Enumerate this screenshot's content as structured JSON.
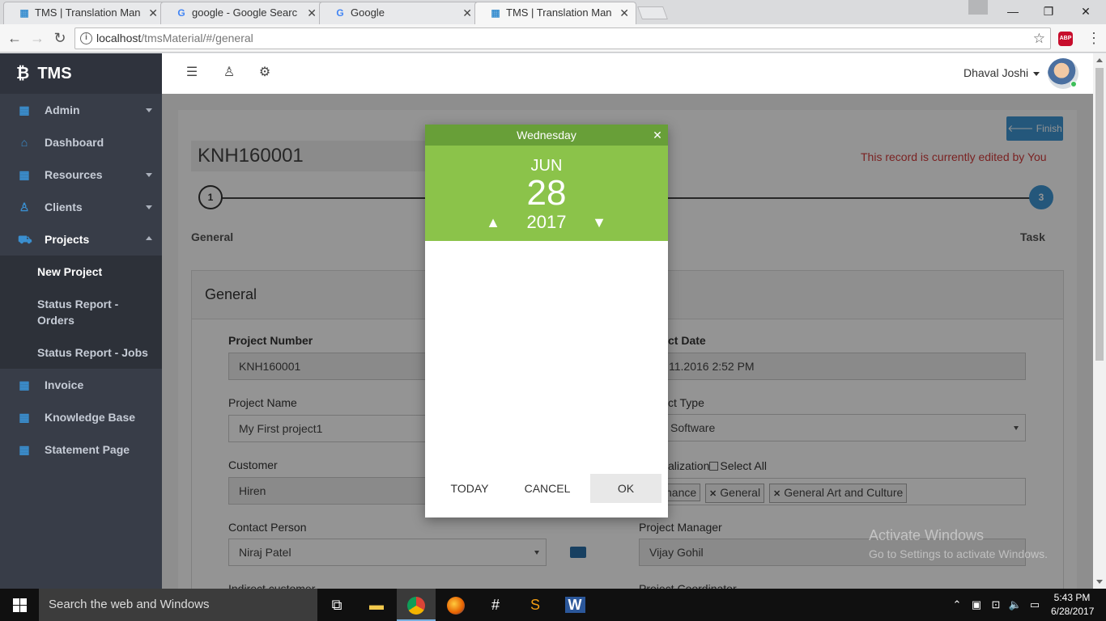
{
  "browser": {
    "tabs": [
      {
        "title": "TMS | Translation Manag",
        "active": false
      },
      {
        "title": "google - Google Search",
        "active": false
      },
      {
        "title": "Google",
        "active": false
      },
      {
        "title": "TMS | Translation Manag",
        "active": true
      }
    ],
    "url_host": "localhost",
    "url_path": "/tmsMaterial/#/general",
    "abp_label": "ABP"
  },
  "sidebar": {
    "brand": "TMS",
    "items": [
      {
        "label": "Admin",
        "icon": "grid-icon",
        "caret": "down"
      },
      {
        "label": "Dashboard",
        "icon": "home-icon",
        "caret": ""
      },
      {
        "label": "Resources",
        "icon": "grid-icon",
        "caret": "down"
      },
      {
        "label": "Clients",
        "icon": "user-icon",
        "caret": "down"
      },
      {
        "label": "Projects",
        "icon": "cart-icon",
        "caret": "up"
      }
    ],
    "sub_items": [
      "New Project",
      "Status Report - Orders",
      "Status Report - Jobs"
    ],
    "items_after": [
      {
        "label": "Invoice",
        "icon": "grid-icon"
      },
      {
        "label": "Knowledge Base",
        "icon": "grid-icon"
      },
      {
        "label": "Statement Page",
        "icon": "grid-icon"
      }
    ]
  },
  "header": {
    "username": "Dhaval Joshi"
  },
  "page": {
    "finish_label": "Finish",
    "record_title": "KNH160001",
    "edited_message": "This record is currently edited by You",
    "steps": {
      "one": "1",
      "three": "3",
      "general_label": "General",
      "task_label": "Task"
    },
    "section_title": "General",
    "fields": {
      "project_number_label": "Project Number",
      "project_number_value": "KNH160001",
      "project_date_label": "ct Date",
      "project_date_value": "11.2016 2:52 PM",
      "project_name_label": "Project Name",
      "project_name_value": "My First project1",
      "project_type_label": "ct Type",
      "project_type_value": "Software",
      "customer_label": "Customer",
      "customer_value": "Hiren",
      "specialization_label": "alization",
      "select_all_label": "Select All",
      "chips": [
        "nance",
        "General",
        "General Art and Culture"
      ],
      "contact_person_label": "Contact Person",
      "contact_person_value": "Niraj Patel",
      "project_manager_label": "Project Manager",
      "project_manager_value": "Vijay Gohil",
      "indirect_customer_label": "Indirect customer",
      "project_coordinator_label": "Project Coordinator"
    }
  },
  "datepicker": {
    "weekday": "Wednesday",
    "month": "JUN",
    "day": "28",
    "year": "2017",
    "today_label": "TODAY",
    "cancel_label": "CANCEL",
    "ok_label": "OK"
  },
  "watermark": {
    "line1": "Activate Windows",
    "line2": "Go to Settings to activate Windows."
  },
  "taskbar": {
    "search_placeholder": "Search the web and Windows",
    "time": "5:43 PM",
    "date": "6/28/2017"
  }
}
